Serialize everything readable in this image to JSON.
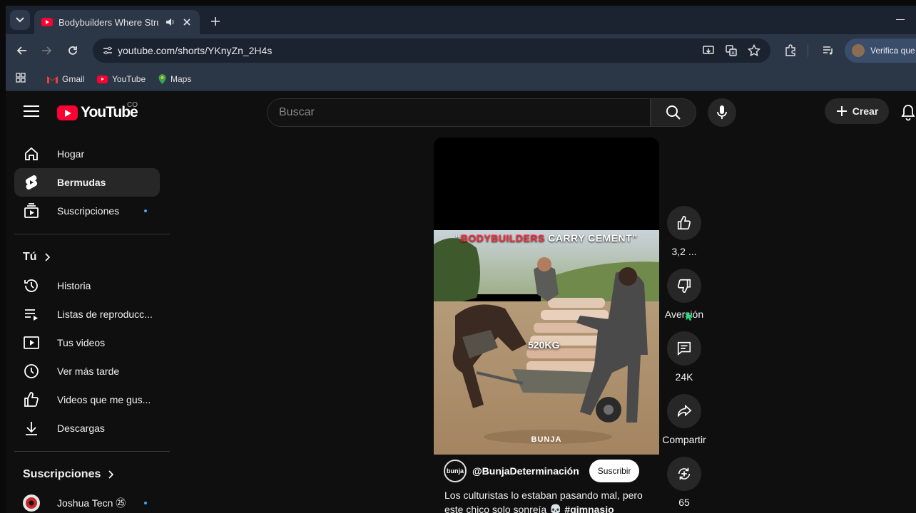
{
  "browser": {
    "tab_title": "Bodybuilders Where Strugg",
    "url": "youtube.com/shorts/YKnyZn_2H4s",
    "profile_label": "Verifica que",
    "bookmarks": [
      {
        "label": "Gmail",
        "icon": "gmail-icon"
      },
      {
        "label": "YouTube",
        "icon": "youtube-icon"
      },
      {
        "label": "Maps",
        "icon": "maps-icon"
      }
    ]
  },
  "header": {
    "logo_text": "YouTube",
    "country_code": "CO",
    "search_placeholder": "Buscar",
    "create_label": "Crear"
  },
  "sidebar": {
    "main": [
      {
        "label": "Hogar",
        "icon": "home-icon"
      },
      {
        "label": "Bermudas",
        "icon": "shorts-icon",
        "active": true
      },
      {
        "label": "Suscripciones",
        "icon": "subscriptions-icon",
        "dot": true
      }
    ],
    "you_heading": "Tú",
    "you": [
      {
        "label": "Historia",
        "icon": "history-icon"
      },
      {
        "label": "Listas de reproducc...",
        "icon": "playlists-icon"
      },
      {
        "label": "Tus videos",
        "icon": "your-videos-icon"
      },
      {
        "label": "Ver más tarde",
        "icon": "watch-later-icon"
      },
      {
        "label": "Videos que me gus...",
        "icon": "liked-videos-icon"
      },
      {
        "label": "Descargas",
        "icon": "downloads-icon"
      }
    ],
    "subs_heading": "Suscripciones",
    "subs": [
      {
        "label": "Joshua Tecn ㉕",
        "icon": "channel-avatar",
        "dot": true
      }
    ]
  },
  "short": {
    "overlay_title_red": "BODYBUILDERS",
    "overlay_title_white": "CARRY CEMENT",
    "weight_label": "520KG",
    "watermark": "BUNJA",
    "channel_avatar_text": "bunja",
    "channel_name": "@BunjaDeterminación",
    "subscribe_label": "Suscribir",
    "caption_line1": "Los culturistas lo estaban pasando mal, pero",
    "caption_line2": "este chico solo sonreía 💀",
    "caption_hashtag": "#gimnasio"
  },
  "actions": [
    {
      "label": "3,2 ...",
      "icon": "like-icon"
    },
    {
      "label": "Aversión",
      "icon": "dislike-icon"
    },
    {
      "label": "24K",
      "icon": "comment-icon"
    },
    {
      "label": "Compartir",
      "icon": "share-icon"
    },
    {
      "label": "65",
      "icon": "remix-icon"
    }
  ],
  "colors": {
    "brand_red": "#ff0033",
    "background": "#0f0f0f",
    "accent_blue": "#3ea6ff"
  }
}
